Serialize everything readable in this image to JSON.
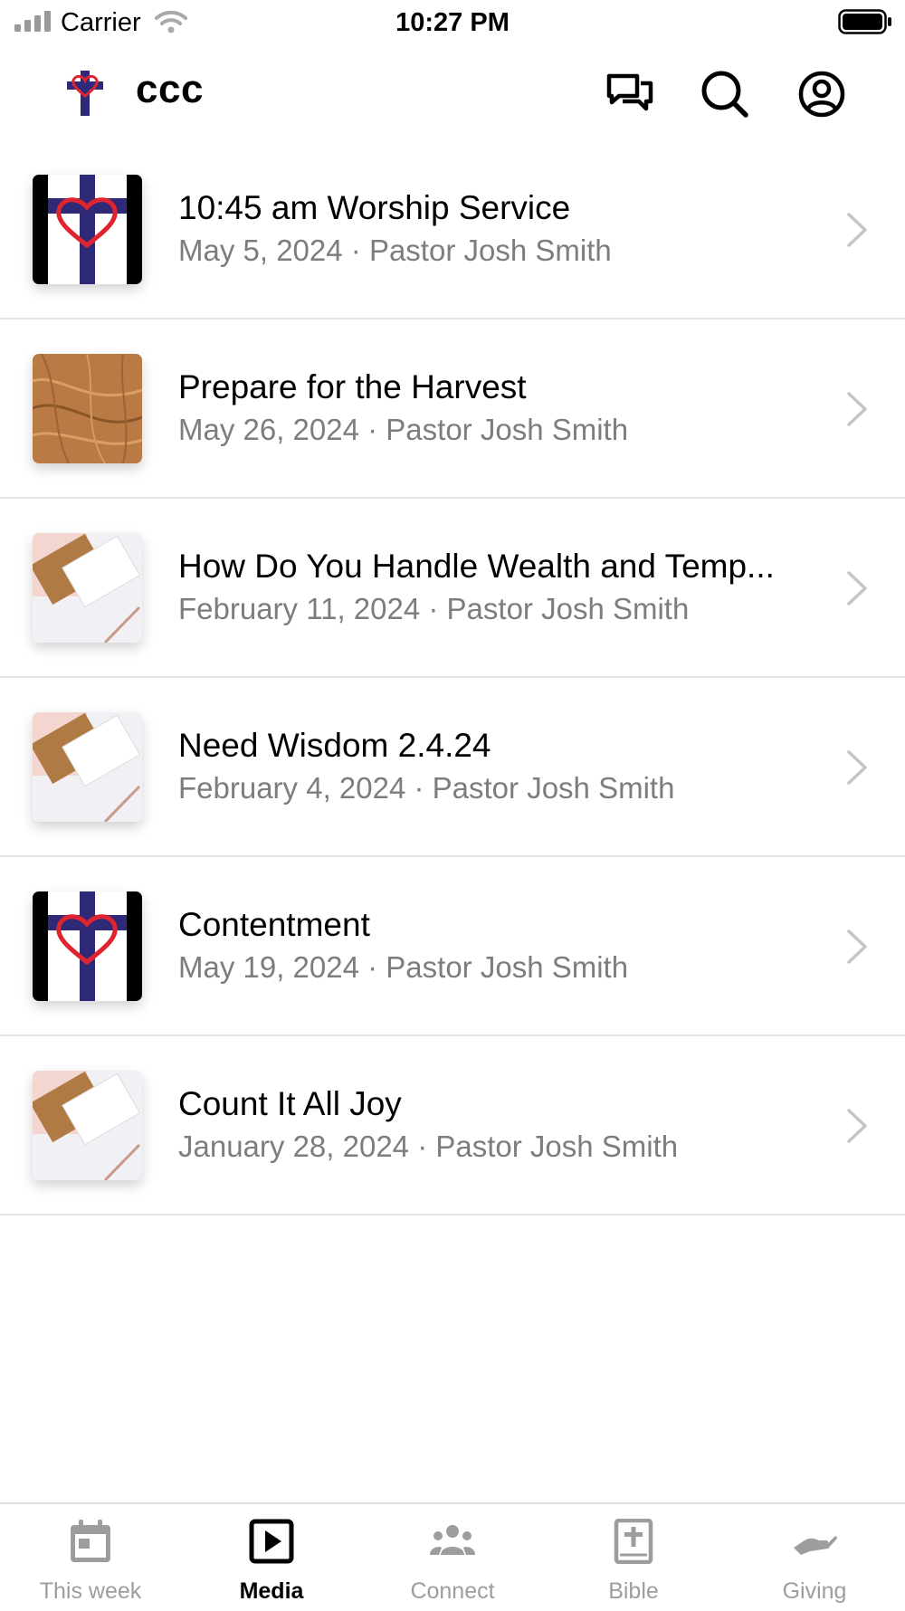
{
  "status_bar": {
    "carrier": "Carrier",
    "time": "10:27 PM"
  },
  "header": {
    "title": "ccc",
    "icons": [
      "logo-cross-icon",
      "chat-icon",
      "search-icon",
      "account-icon"
    ]
  },
  "media": {
    "items": [
      {
        "title": "10:45 am Worship Service",
        "subtitle": "May 5, 2024 · Pastor Josh Smith",
        "thumbnail": "cross-heart"
      },
      {
        "title": "Prepare for the Harvest",
        "subtitle": "May 26, 2024 · Pastor Josh Smith",
        "thumbnail": "wheat-field"
      },
      {
        "title": "How Do You Handle Wealth and Temp...",
        "subtitle": "February 11, 2024 · Pastor Josh Smith",
        "thumbnail": "notepad"
      },
      {
        "title": "Need Wisdom 2.4.24",
        "subtitle": "February 4, 2024 · Pastor Josh Smith",
        "thumbnail": "notepad"
      },
      {
        "title": "Contentment",
        "subtitle": "May 19, 2024 · Pastor Josh Smith",
        "thumbnail": "cross-heart"
      },
      {
        "title": "Count It All Joy",
        "subtitle": "January 28, 2024 · Pastor Josh Smith",
        "thumbnail": "notepad"
      }
    ]
  },
  "tabs": [
    {
      "label": "This week",
      "icon": "calendar-icon",
      "active": false
    },
    {
      "label": "Media",
      "icon": "play-icon",
      "active": true
    },
    {
      "label": "Connect",
      "icon": "people-icon",
      "active": false
    },
    {
      "label": "Bible",
      "icon": "bible-icon",
      "active": false
    },
    {
      "label": "Giving",
      "icon": "giving-hand-icon",
      "active": false
    }
  ],
  "colors": {
    "brand_navy": "#2e2a78",
    "brand_red": "#e0242f",
    "secondary_text": "#7d7d7d",
    "inactive_tab": "#9d9d9d",
    "active_tab": "#000000"
  }
}
